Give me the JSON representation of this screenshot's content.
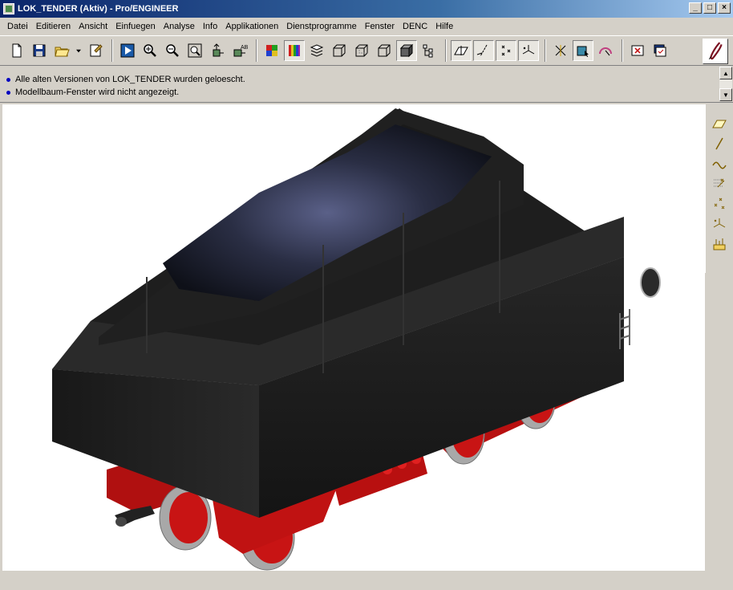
{
  "window": {
    "title": "LOK_TENDER (Aktiv) - Pro/ENGINEER",
    "minimize": "_",
    "maximize": "□",
    "close": "×"
  },
  "menu": [
    {
      "label": "Datei"
    },
    {
      "label": "Editieren"
    },
    {
      "label": "Ansicht"
    },
    {
      "label": "Einfuegen"
    },
    {
      "label": "Analyse"
    },
    {
      "label": "Info"
    },
    {
      "label": "Applikationen"
    },
    {
      "label": "Dienstprogramme"
    },
    {
      "label": "Fenster"
    },
    {
      "label": "DENC"
    },
    {
      "label": "Hilfe"
    }
  ],
  "toolbar": {
    "icons": [
      "new-file-icon",
      "save-icon",
      "open-folder-icon",
      "open-dropdown-icon",
      "erase-icon",
      "repaint-icon",
      "zoom-in-icon",
      "zoom-out-icon",
      "refit-icon",
      "orient-icon",
      "saved-views-icon",
      "color-scheme-icon",
      "shading-colors-icon",
      "layers-icon",
      "wireframe-icon",
      "hidden-line-icon",
      "no-hidden-icon",
      "shaded-icon",
      "model-tree-icon",
      "datum-planes-icon",
      "datum-axes-icon",
      "datum-points-icon",
      "coord-systems-icon",
      "spin-center-icon",
      "select-icon",
      "sketcher-icon",
      "close-window-icon",
      "activate-window-icon",
      "sketch-pencil-icon"
    ]
  },
  "messages": [
    {
      "text": "Alle alten Versionen von LOK_TENDER wurden geloescht."
    },
    {
      "text": "Modellbaum-Fenster wird nicht angezeigt."
    }
  ],
  "right_toolbar": {
    "icons": [
      "datum-plane-tool-icon",
      "datum-axis-tool-icon",
      "datum-curve-tool-icon",
      "datum-point-tool-icon",
      "offset-point-tool-icon",
      "coordinate-system-tool-icon",
      "analysis-feature-icon"
    ]
  },
  "model": {
    "name": "LOK_TENDER",
    "body_color": "#1c1c1c",
    "coal_color": "#232a3a",
    "wheel_color": "#c81414",
    "tire_color": "#b0b0b0"
  }
}
